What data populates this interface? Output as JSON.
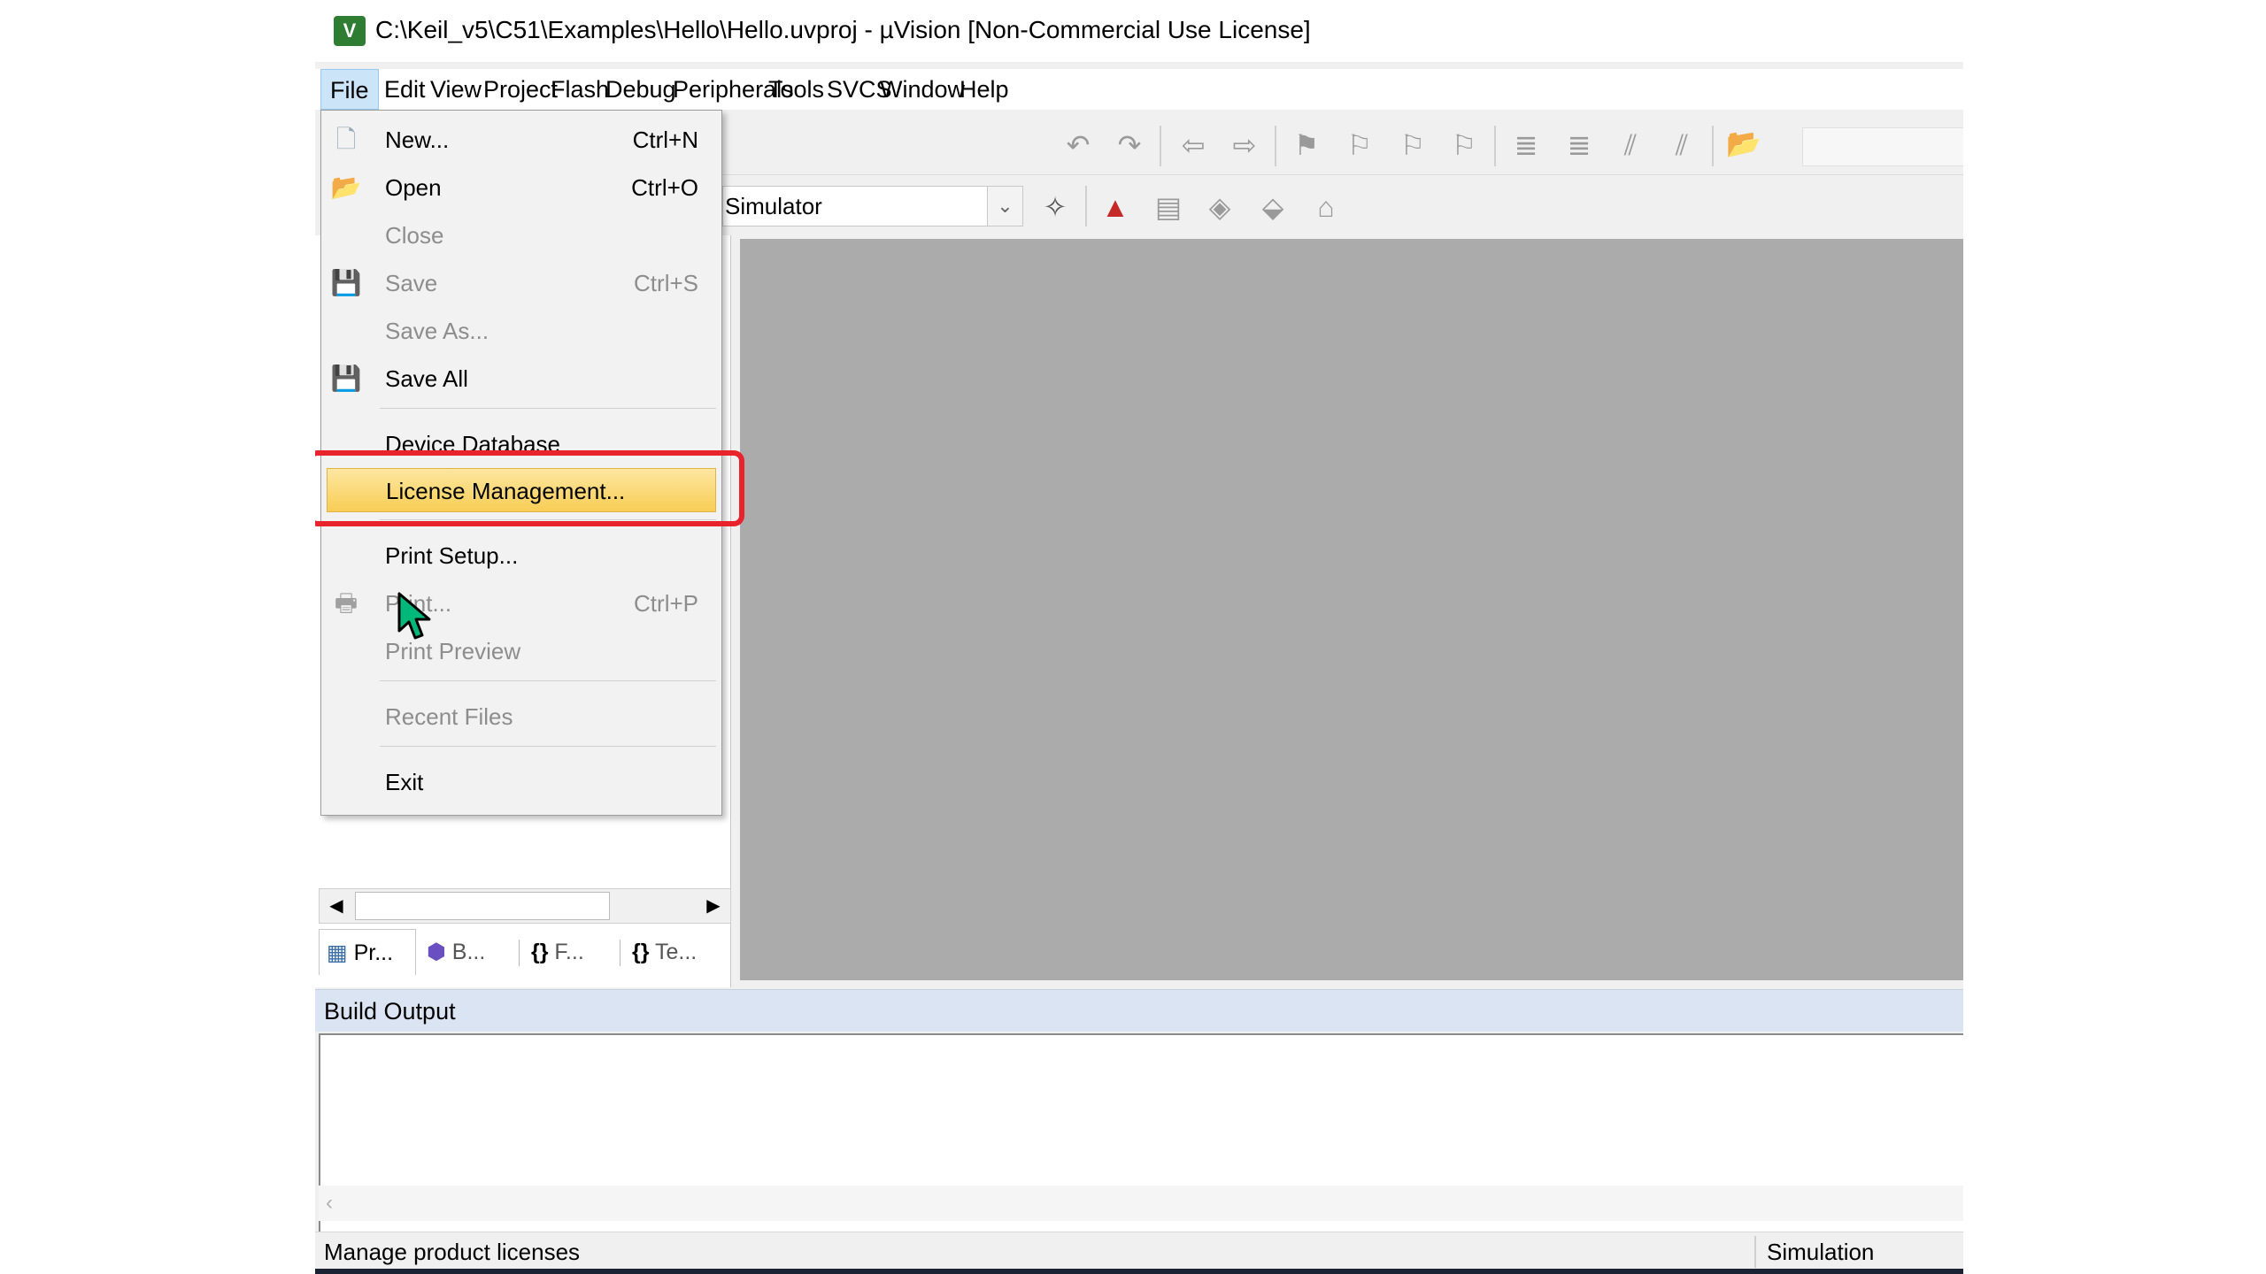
{
  "window": {
    "title": "C:\\Keil_v5\\C51\\Examples\\Hello\\Hello.uvproj - µVision  [Non-Commercial Use License]",
    "app_icon": "uvision-icon"
  },
  "menubar": {
    "items": [
      "File",
      "Edit",
      "View",
      "Project",
      "Flash",
      "Debug",
      "Peripherals",
      "Tools",
      "SVCS",
      "Window",
      "Help"
    ],
    "active": "File"
  },
  "toolbar": {
    "icons": [
      "undo-icon",
      "redo-icon",
      "back-icon",
      "forward-icon",
      "bookmark-icon",
      "prev-bookmark-icon",
      "next-bookmark-icon",
      "clear-bookmarks-icon",
      "indent-icon",
      "unindent-icon",
      "comment-icon",
      "uncomment-icon",
      "find-in-files-icon",
      "find-combo",
      "search-icon",
      "tools-icon",
      "debug-icon"
    ],
    "target_label": "Simulator",
    "target_icons": [
      "magic-wand-icon",
      "components-icon",
      "rte-icon",
      "pack-icon",
      "select-packs-icon",
      "books-icon"
    ]
  },
  "file_menu": {
    "items": [
      {
        "label": "New...",
        "shortcut": "Ctrl+N",
        "enabled": true,
        "icon": "new-file-icon"
      },
      {
        "label": "Open",
        "shortcut": "Ctrl+O",
        "enabled": true,
        "icon": "open-folder-icon"
      },
      {
        "label": "Close",
        "shortcut": "",
        "enabled": false
      },
      {
        "label": "Save",
        "shortcut": "Ctrl+S",
        "enabled": false,
        "icon": "save-icon"
      },
      {
        "label": "Save As...",
        "shortcut": "",
        "enabled": false
      },
      {
        "label": "Save All",
        "shortcut": "",
        "enabled": true,
        "icon": "save-all-icon"
      },
      {
        "label": "Device Database",
        "shortcut": "",
        "enabled": true
      },
      {
        "label": "License Management...",
        "shortcut": "",
        "enabled": true,
        "highlighted": true
      },
      {
        "label": "Print Setup...",
        "shortcut": "",
        "enabled": true
      },
      {
        "label": "Print...",
        "shortcut": "Ctrl+P",
        "enabled": false,
        "icon": "print-icon"
      },
      {
        "label": "Print Preview",
        "shortcut": "",
        "enabled": false
      },
      {
        "label": "Recent Files",
        "shortcut": "",
        "enabled": false
      },
      {
        "label": "Exit",
        "shortcut": "",
        "enabled": true
      }
    ],
    "highlight_color": "#e8232b"
  },
  "project_tabs": [
    "Pr...",
    "B...",
    "F...",
    "Te..."
  ],
  "build_output": {
    "title": "Build Output"
  },
  "status_bar": {
    "message": "Manage product licenses",
    "mode": "Simulation"
  }
}
